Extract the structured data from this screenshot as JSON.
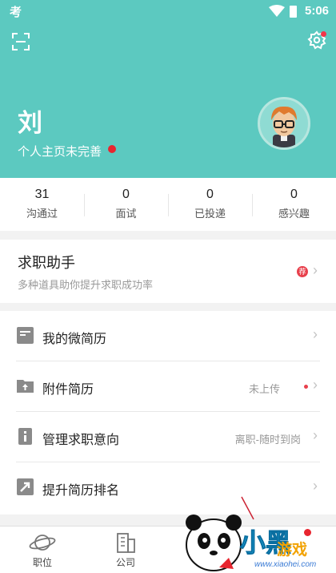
{
  "status_bar": {
    "app_glyph": "考",
    "time": "5:06"
  },
  "profile": {
    "name": "刘",
    "hint": "个人主页未完善"
  },
  "stats": [
    {
      "value": "31",
      "label": "沟通过"
    },
    {
      "value": "0",
      "label": "面试"
    },
    {
      "value": "0",
      "label": "已投递"
    },
    {
      "value": "0",
      "label": "感兴趣"
    }
  ],
  "assistant": {
    "title": "求职助手",
    "subtitle": "多种道具助你提升求职成功率",
    "badge": "荐"
  },
  "menu": [
    {
      "label": "我的微简历",
      "value": "",
      "icon": "document-icon"
    },
    {
      "label": "附件简历",
      "value": "未上传",
      "icon": "folder-upload-icon"
    },
    {
      "label": "管理求职意向",
      "value": "离职-随时到岗",
      "icon": "info-icon"
    },
    {
      "label": "提升简历排名",
      "value": "",
      "icon": "arrow-up-icon"
    }
  ],
  "bottom_nav": [
    {
      "label": "职位",
      "icon": "planet-icon"
    },
    {
      "label": "公司",
      "icon": "building-icon"
    }
  ],
  "watermark": {
    "text": "小黑",
    "sub": "游戏",
    "url": "www.xiaohei.com"
  },
  "colors": {
    "header": "#5cc9c0",
    "red_dot": "#e8252f",
    "text_dark": "#222222",
    "text_muted": "#999999"
  }
}
